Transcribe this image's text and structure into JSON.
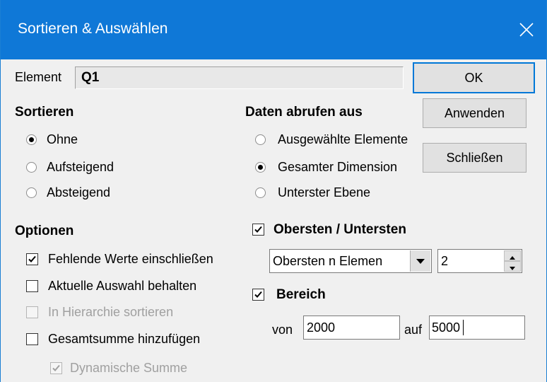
{
  "window": {
    "title": "Sortieren & Auswählen"
  },
  "element": {
    "label": "Element",
    "value": "Q1"
  },
  "buttons": {
    "ok": "OK",
    "apply": "Anwenden",
    "close": "Schließen"
  },
  "sort": {
    "heading": "Sortieren",
    "options": [
      "Ohne",
      "Aufsteigend",
      "Absteigend"
    ],
    "selected": "Ohne"
  },
  "data_source": {
    "heading": "Daten abrufen aus",
    "options": [
      "Ausgewählte Elemente",
      "Gesamter Dimension",
      "Unterster Ebene"
    ],
    "selected": "Gesamter Dimension"
  },
  "options": {
    "heading": "Optionen",
    "items": [
      {
        "label": "Fehlende Werte einschließen",
        "checked": true,
        "enabled": true
      },
      {
        "label": "Aktuelle Auswahl behalten",
        "checked": false,
        "enabled": true
      },
      {
        "label": "In Hierarchie sortieren",
        "checked": false,
        "enabled": false
      },
      {
        "label": "Gesamtsumme hinzufügen",
        "checked": false,
        "enabled": true
      },
      {
        "label": "Dynamische Summe",
        "checked": true,
        "enabled": false
      }
    ]
  },
  "top_bottom": {
    "label": "Obersten / Untersten",
    "checked": true,
    "mode": "Obersten n Elemen",
    "count": "2"
  },
  "range": {
    "label": "Bereich",
    "checked": true,
    "from_label": "von",
    "from_value": "2000",
    "to_label": "auf",
    "to_value": "5000"
  }
}
